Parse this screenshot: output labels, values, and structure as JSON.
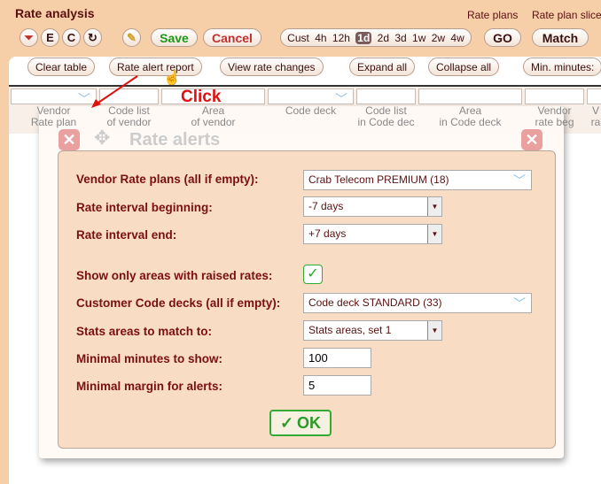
{
  "app": {
    "title": "Rate analysis",
    "links": [
      "Rate plans",
      "Rate plan slice"
    ]
  },
  "toolbar": {
    "icons": [
      "filter-clear-icon",
      "E",
      "C",
      "refresh-icon",
      "pencil-icon"
    ],
    "save": "Save",
    "cancel": "Cancel",
    "periods": [
      "Cust",
      "4h",
      "12h",
      "1d",
      "2d",
      "3d",
      "1w",
      "2w",
      "4w"
    ],
    "selected_period": "1d",
    "go": "GO",
    "match": "Match"
  },
  "actions": {
    "clear": "Clear table",
    "rate_alert": "Rate alert report",
    "view_changes": "View rate changes",
    "expand": "Expand all",
    "collapse": "Collapse all",
    "min_minutes": "Min. minutes:"
  },
  "columns": [
    [
      "Vendor",
      "Rate plan"
    ],
    [
      "Code list",
      "of vendor"
    ],
    [
      "Area",
      "of vendor"
    ],
    [
      "Code deck",
      ""
    ],
    [
      "Code list",
      "in Code dec"
    ],
    [
      "Area",
      "in Code deck"
    ],
    [
      "Vendor",
      "rate beg"
    ],
    [
      "V",
      "ra"
    ]
  ],
  "annotation": {
    "click": "Click"
  },
  "dialog": {
    "title": "Rate alerts",
    "fields": {
      "vendor_label": "Vendor Rate plans (all if empty):",
      "vendor_value": "Crab Telecom PREMIUM (18)",
      "begin_label": "Rate interval beginning:",
      "begin_value": "-7 days",
      "end_label": "Rate interval end:",
      "end_value": "+7 days",
      "raised_label": "Show only areas with raised rates:",
      "raised_checked": true,
      "codedeck_label": "Customer Code decks (all if empty):",
      "codedeck_value": "Code deck STANDARD (33)",
      "stats_label": "Stats areas to match to:",
      "stats_value": "Stats areas, set 1",
      "minutes_label": "Minimal minutes to show:",
      "minutes_value": "100",
      "margin_label": "Minimal margin for alerts:",
      "margin_value": "5"
    },
    "ok": "OK"
  },
  "colors": {
    "background": "#f6cfa8",
    "label": "#7a1010",
    "save": "#1a9a1a",
    "cancel": "#c03030",
    "annotation": "#e01010"
  }
}
